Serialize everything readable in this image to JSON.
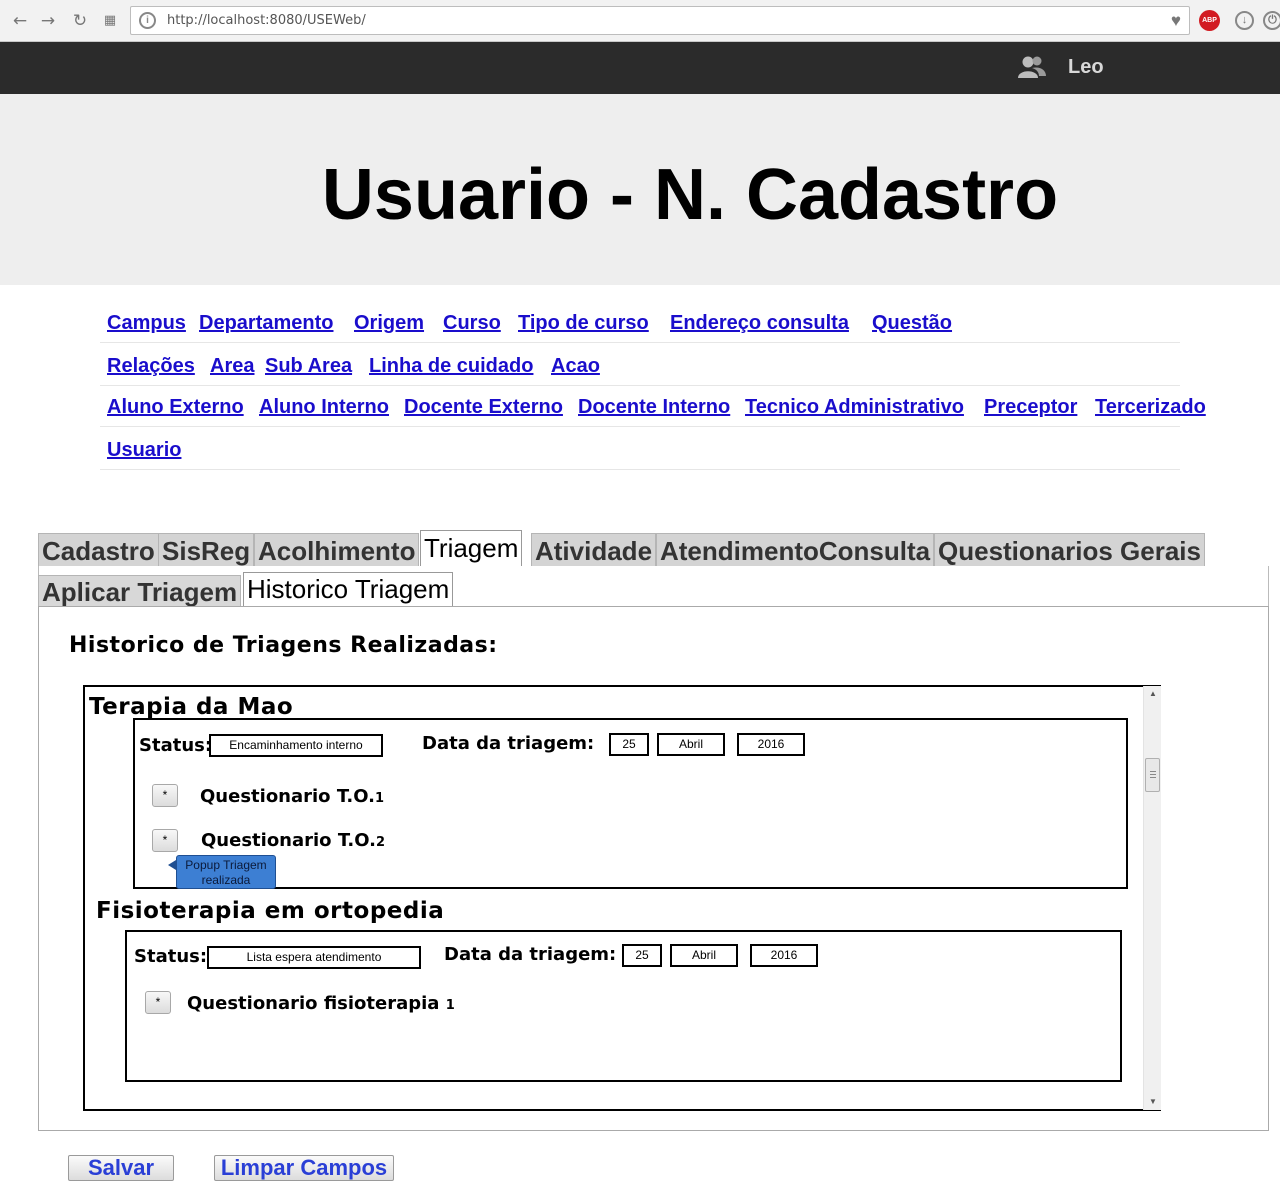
{
  "browser": {
    "url": "http://localhost:8080/USEWeb/",
    "abp_label": "ABP"
  },
  "header": {
    "user_name": "Leo",
    "page_title": "Usuario - N. Cadastro"
  },
  "menu": {
    "row1": [
      "Campus",
      "Departamento",
      "Origem",
      "Curso",
      "Tipo de curso",
      "Endereço consulta",
      "Questão"
    ],
    "row2": [
      "Relações",
      "Area",
      "Sub Area",
      "Linha de cuidado",
      "Acao"
    ],
    "row3": [
      "Aluno Externo",
      "Aluno Interno",
      "Docente Externo",
      "Docente Interno",
      "Tecnico Administrativo",
      "Preceptor",
      "Tercerizado"
    ],
    "row4": [
      "Usuario"
    ]
  },
  "tabs": [
    "Cadastro",
    "SisReg",
    "Acolhimento",
    "Triagem",
    "Atividade",
    "AtendimentoConsulta",
    "Questionarios Gerais"
  ],
  "active_tab": "Triagem",
  "subtabs": [
    "Aplicar Triagem",
    "Historico Triagem"
  ],
  "active_subtab": "Historico Triagem",
  "content": {
    "section_title": "Historico de Triagens Realizadas:",
    "groups": [
      {
        "title": "Terapia da Mao",
        "status_label": "Status:",
        "status_value": "Encaminhamento interno",
        "date_label": "Data da triagem:",
        "day": "25",
        "month": "Abril",
        "year": "2016",
        "questionnaires": [
          {
            "button": "*",
            "name": "Questionario T.O.",
            "number": "1"
          },
          {
            "button": "*",
            "name": "Questionario T.O.",
            "number": "2"
          }
        ],
        "tooltip": "Popup Triagem realizada"
      },
      {
        "title": "Fisioterapia em ortopedia",
        "status_label": "Status:",
        "status_value": "Lista espera atendimento",
        "date_label": "Data da triagem:",
        "day": "25",
        "month": "Abril",
        "year": "2016",
        "questionnaires": [
          {
            "button": "*",
            "name": "Questionario fisioterapia",
            "number": "1"
          }
        ]
      }
    ]
  },
  "actions": {
    "save_label": "Salvar",
    "clear_label": "Limpar Campos"
  },
  "colors": {
    "link": "#1a0dcc",
    "topbar": "#2b2b2b",
    "hero": "#eeeeee",
    "tooltip": "#3d7fd3",
    "button_text": "#2a3fd6"
  }
}
